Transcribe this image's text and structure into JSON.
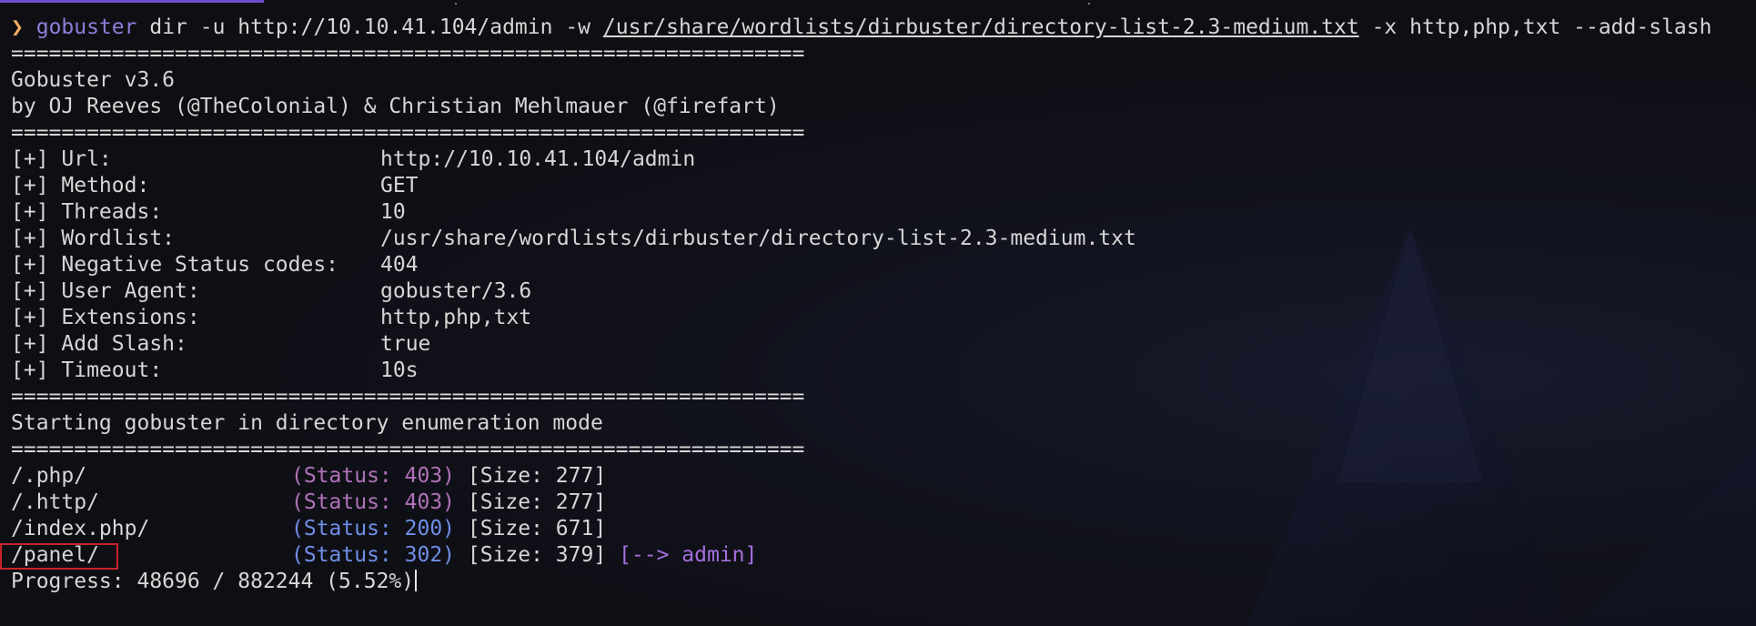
{
  "command": {
    "prompt": "❯",
    "program": "gobuster",
    "args_before": "dir -u http://10.10.41.104/admin -w",
    "wordlist": "/usr/share/wordlists/dirbuster/directory-list-2.3-medium.txt",
    "args_after": "-x http,php,txt --add-slash"
  },
  "separator": "===============================================================",
  "banner": {
    "version": "Gobuster v3.6",
    "authors": "by OJ Reeves (@TheColonial) & Christian Mehlmauer (@firefart)"
  },
  "config": [
    {
      "label": "[+] Url:",
      "value": "http://10.10.41.104/admin"
    },
    {
      "label": "[+] Method:",
      "value": "GET"
    },
    {
      "label": "[+] Threads:",
      "value": "10"
    },
    {
      "label": "[+] Wordlist:",
      "value": "/usr/share/wordlists/dirbuster/directory-list-2.3-medium.txt"
    },
    {
      "label": "[+] Negative Status codes:",
      "value": "404"
    },
    {
      "label": "[+] User Agent:",
      "value": "gobuster/3.6"
    },
    {
      "label": "[+] Extensions:",
      "value": "http,php,txt"
    },
    {
      "label": "[+] Add Slash:",
      "value": "true"
    },
    {
      "label": "[+] Timeout:",
      "value": "10s"
    }
  ],
  "mode_message": "Starting gobuster in directory enumeration mode",
  "results": [
    {
      "path": "/.php/",
      "status": "(Status: 403)",
      "size": "[Size: 277]",
      "redirect": ""
    },
    {
      "path": "/.http/",
      "status": "(Status: 403)",
      "size": "[Size: 277]",
      "redirect": ""
    },
    {
      "path": "/index.php/",
      "status": "(Status: 200)",
      "size": "[Size: 671]",
      "redirect": ""
    },
    {
      "path": "/panel/",
      "status": "(Status: 302)",
      "size": "[Size: 379]",
      "redirect": "[--> admin]"
    }
  ],
  "progress": "Progress: 48696 / 882244 (5.52%)",
  "colors": {
    "background": "#0f0f14",
    "status_403": "#b072b8",
    "status_200": "#6f8fe6",
    "status_302": "#6f8fe6",
    "redirect": "#a46fe0",
    "prompt": "#f0b060",
    "program": "#8b7fd8",
    "highlight_box": "#c8232c"
  }
}
